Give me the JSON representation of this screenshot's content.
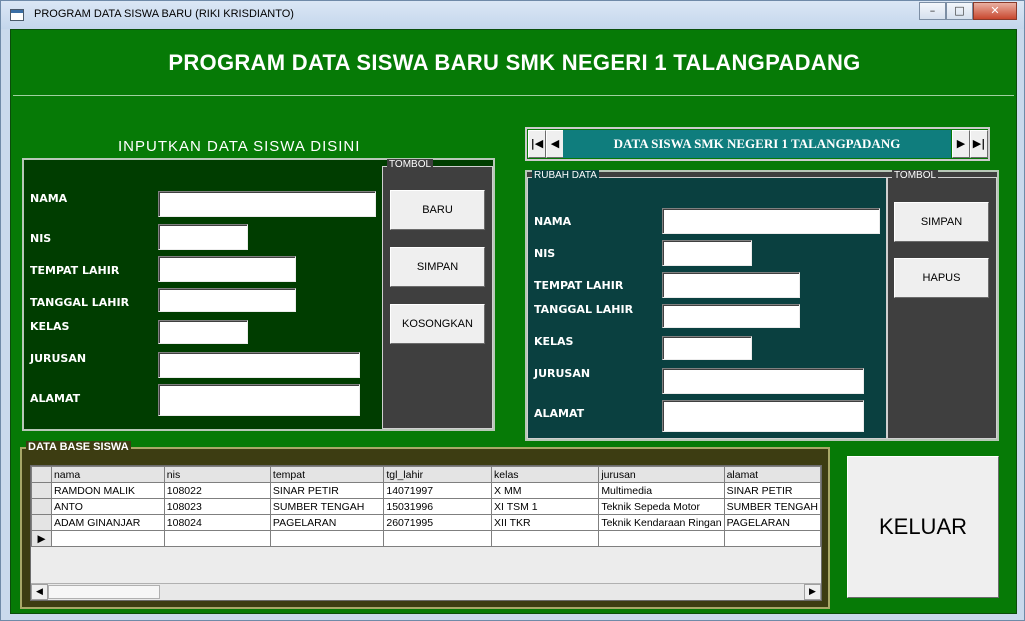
{
  "window": {
    "title": "PROGRAM DATA SISWA BARU (RIKI KRISDIANTO)",
    "minimize": "–",
    "maximize": "□",
    "close": "✕"
  },
  "header": {
    "title": "PROGRAM DATA SISWA BARU SMK NEGERI 1 TALANGPADANG"
  },
  "input_form": {
    "heading": "INPUTKAN DATA SISWA DISINI",
    "group_label": "TOMBOL",
    "labels": {
      "nama": "NAMA",
      "nis": "NIS",
      "tempat_lahir": "TEMPAT LAHIR",
      "tanggal_lahir": "TANGGAL LAHIR",
      "kelas": "KELAS",
      "jurusan": "JURUSAN",
      "alamat": "ALAMAT"
    },
    "values": {
      "nama": "",
      "nis": "",
      "tempat_lahir": "",
      "tanggal_lahir": "",
      "kelas": "",
      "jurusan": "",
      "alamat": ""
    },
    "buttons": {
      "baru": "BARU",
      "simpan": "SIMPAN",
      "kosongkan": "KOSONGKAN"
    }
  },
  "navigator": {
    "caption": "DATA SISWA SMK NEGERI 1 TALANGPADANG",
    "first": "|◀",
    "prev": "◀",
    "next": "▶",
    "last": "▶|"
  },
  "edit_form": {
    "group_label": "RUBAH DATA",
    "button_group_label": "TOMBOL",
    "labels": {
      "nama": "NAMA",
      "nis": "NIS",
      "tempat_lahir": "TEMPAT LAHIR",
      "tanggal_lahir": "TANGGAL LAHIR",
      "kelas": "KELAS",
      "jurusan": "JURUSAN",
      "alamat": "ALAMAT"
    },
    "values": {
      "nama": "",
      "nis": "",
      "tempat_lahir": "",
      "tanggal_lahir": "",
      "kelas": "",
      "jurusan": "",
      "alamat": ""
    },
    "buttons": {
      "simpan": "SIMPAN",
      "hapus": "HAPUS"
    }
  },
  "database": {
    "group_label": "DATA BASE SISWA",
    "columns": [
      "nama",
      "nis",
      "tempat",
      "tgl_lahir",
      "kelas",
      "jurusan",
      "alamat"
    ],
    "rows": [
      [
        "RAMDON MALIK",
        "108022",
        "SINAR PETIR",
        "14071997",
        "X MM",
        "Multimedia",
        "SINAR PETIR"
      ],
      [
        "ANTO",
        "108023",
        "SUMBER TENGAH",
        "15031996",
        "XI TSM 1",
        "Teknik Sepeda Motor",
        "SUMBER TENGAH"
      ],
      [
        "ADAM GINANJAR",
        "108024",
        "PAGELARAN",
        "26071995",
        "XII TKR",
        "Teknik Kendaraan Ringan",
        "PAGELARAN"
      ]
    ],
    "new_row_marker": "▶",
    "scroll_left": "◀",
    "scroll_right": "▶"
  },
  "exit_button": {
    "label": "KELUAR"
  },
  "colors": {
    "form_bg": "#003d00",
    "button_panel_bg": "#3f3f3f",
    "edit_bg": "#0a4040",
    "client_bg": "#067a06",
    "nav_caption_bg": "#0f7d7d"
  }
}
